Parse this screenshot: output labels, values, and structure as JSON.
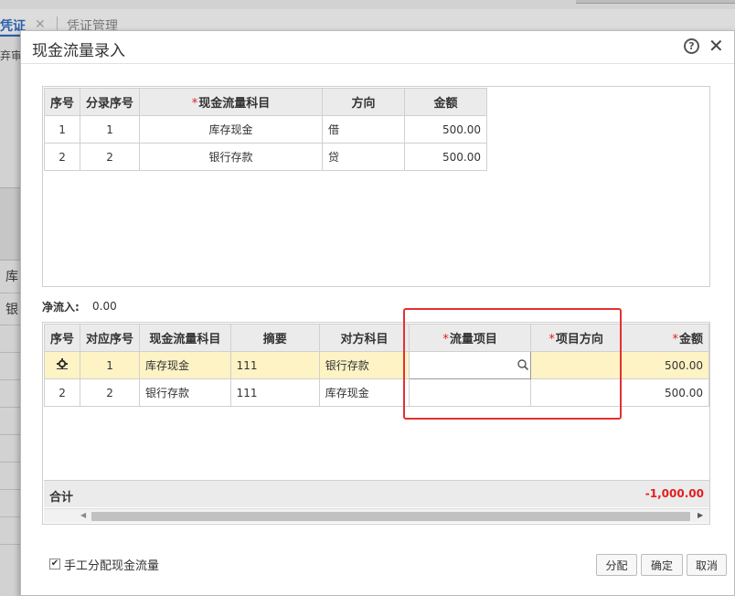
{
  "background": {
    "tab_active": "凭证",
    "tab_close": "✕",
    "tab_other": "凭证管理",
    "sub_text": "弃审",
    "side_text_1": "库",
    "side_text_2": "银"
  },
  "dialog": {
    "title": "现金流量录入",
    "help_icon": "?",
    "close_icon": "✕"
  },
  "top_table": {
    "headers": {
      "seq": "序号",
      "entry_seq": "分录序号",
      "account": "现金流量科目",
      "direction": "方向",
      "amount": "金额"
    },
    "rows": [
      {
        "seq": "1",
        "entry_seq": "1",
        "account": "库存现金",
        "direction": "借",
        "amount": "500.00"
      },
      {
        "seq": "2",
        "entry_seq": "2",
        "account": "银行存款",
        "direction": "贷",
        "amount": "500.00"
      }
    ]
  },
  "net_inflow": {
    "label": "净流入:",
    "value": "0.00"
  },
  "bottom_table": {
    "headers": {
      "seq": "序号",
      "corr_seq": "对应序号",
      "account": "现金流量科目",
      "summary": "摘要",
      "counter_account": "对方科目",
      "flow_item": "流量项目",
      "item_direction": "项目方向",
      "amount": "金额"
    },
    "rows": [
      {
        "seq": "",
        "corr_seq": "1",
        "account": "库存现金",
        "summary": "111",
        "counter_account": "银行存款",
        "flow_item": "",
        "item_direction": "",
        "amount": "500.00"
      },
      {
        "seq": "2",
        "corr_seq": "2",
        "account": "银行存款",
        "summary": "111",
        "counter_account": "库存现金",
        "flow_item": "",
        "item_direction": "",
        "amount": "500.00"
      }
    ],
    "total_label": "合计",
    "total_value": "-1,000.00"
  },
  "footer": {
    "checkbox_checked": true,
    "checkbox_mark": "✔",
    "checkbox_label": "手工分配现金流量",
    "allocate_label": "分配",
    "confirm_label": "确定",
    "cancel_label": "取消"
  },
  "colors": {
    "required_mark": "#e02020",
    "selected_row": "#fdf3c5",
    "annotation": "#e53030",
    "total_negative": "#e02020"
  }
}
